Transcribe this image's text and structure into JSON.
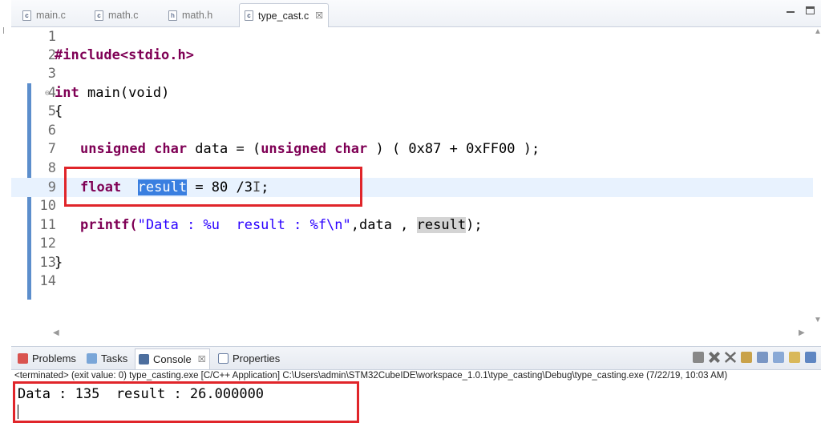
{
  "editor_tabs": [
    {
      "label": "main.c",
      "icon": "c-file-icon",
      "active": false
    },
    {
      "label": "math.c",
      "icon": "c-file-icon",
      "active": false
    },
    {
      "label": "math.h",
      "icon": "h-file-icon",
      "active": false
    },
    {
      "label": "type_cast.c",
      "icon": "c-file-icon",
      "active": true,
      "close": "☒"
    }
  ],
  "code": {
    "line_numbers": [
      "1",
      "2",
      "3",
      "4",
      "5",
      "6",
      "7",
      "8",
      "9",
      "10",
      "11",
      "12",
      "13",
      "14"
    ],
    "current_line": 9,
    "lines": {
      "l2": "#include<stdio.h>",
      "l4_kw": "int",
      "l4_rest": " main(void)",
      "l5": "{",
      "l7_kw1": "unsigned char",
      "l7_mid": " data = (",
      "l7_kw2": "unsigned char",
      "l7_rest": " ) ( 0x87 + 0xFF00 );",
      "l9_kw": "float",
      "l9_sp": "  ",
      "l9_sel": "result",
      "l9_rest": " = 80 /3",
      "l9_cursor": "I",
      "l9_end": ";",
      "l11_a": "printf(",
      "l11_str": "\"Data : %u  result : %f\\n\"",
      "l11_b": ",data , ",
      "l11_occ": "result",
      "l11_c": ");",
      "l13": "}"
    }
  },
  "panel": {
    "tabs": [
      {
        "label": "Problems",
        "icon": "problems-icon"
      },
      {
        "label": "Tasks",
        "icon": "tasks-icon"
      },
      {
        "label": "Console",
        "icon": "console-icon",
        "active": true,
        "close": "☒"
      },
      {
        "label": "Properties",
        "icon": "properties-icon"
      }
    ],
    "status": "<terminated> (exit value: 0) type_casting.exe [C/C++ Application] C:\\Users\\admin\\STM32CubeIDE\\workspace_1.0.1\\type_casting\\Debug\\type_casting.exe (7/22/19, 10:03 AM)",
    "output": "Data : 135  result : 26.000000"
  },
  "colors": {
    "highlight_box": "#e0252a",
    "keyword": "#7f0055",
    "string": "#2a00ff",
    "selection": "#3a7fe0"
  }
}
